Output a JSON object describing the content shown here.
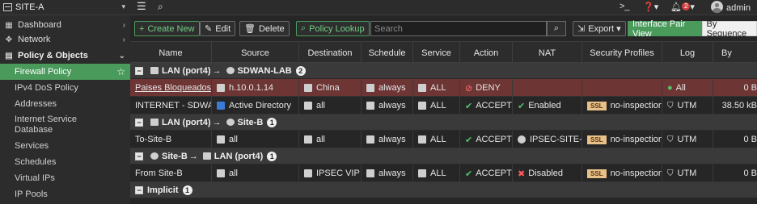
{
  "sidebar": {
    "device_name": "SITE-A",
    "items": [
      {
        "label": "Dashboard",
        "icon": "dashboard-icon"
      },
      {
        "label": "Network",
        "icon": "network-icon"
      },
      {
        "label": "Policy & Objects",
        "icon": "policy-icon"
      }
    ],
    "sub_items": [
      "Firewall Policy",
      "IPv4 DoS Policy",
      "Addresses",
      "Internet Service Database",
      "Services",
      "Schedules",
      "Virtual IPs",
      "IP Pools"
    ]
  },
  "topbar": {
    "menu_icon": "hamburger-icon",
    "search_icon": "search-icon",
    "cli_icon": "terminal-icon",
    "help_icon": "help-icon",
    "notification_count": "2",
    "user": "admin"
  },
  "toolbar": {
    "create_new": "Create New",
    "edit": "Edit",
    "delete": "Delete",
    "policy_lookup": "Policy Lookup",
    "search_placeholder": "Search",
    "export": "Export",
    "view_interface_pair": "Interface Pair View",
    "view_sequence": "By Sequence"
  },
  "table": {
    "columns": [
      "Name",
      "Source",
      "Destination",
      "Schedule",
      "Service",
      "Action",
      "NAT",
      "Security Profiles",
      "Log",
      "By"
    ],
    "groups": [
      {
        "from": "LAN (port4)",
        "to": "SDWAN-LAB",
        "count": "2",
        "rows": [
          {
            "name": "Paises Bloqueados",
            "source": "h.10.0.1.14",
            "destination": "China",
            "schedule": "always",
            "service": "ALL",
            "action": "DENY",
            "nat": "",
            "ssl": "",
            "profile": "",
            "log": "All",
            "bytes": "0 B"
          },
          {
            "name": "INTERNET - SDWAN",
            "source": "Active Directory",
            "destination": "all",
            "schedule": "always",
            "service": "ALL",
            "action": "ACCEPT",
            "nat": "Enabled",
            "ssl": "SSL",
            "profile": "no-inspection",
            "log": "UTM",
            "bytes": "38.50 kB"
          }
        ]
      },
      {
        "from": "LAN (port4)",
        "to": "Site-B",
        "count": "1",
        "rows": [
          {
            "name": "To-Site-B",
            "source": "all",
            "destination": "all",
            "schedule": "always",
            "service": "ALL",
            "action": "ACCEPT",
            "nat": "IPSEC-SITE-A",
            "ssl": "SSL",
            "profile": "no-inspection",
            "log": "UTM",
            "bytes": "0 B"
          }
        ]
      },
      {
        "from": "Site-B",
        "to": "LAN (port4)",
        "count": "1",
        "rows": [
          {
            "name": "From Site-B",
            "source": "all",
            "destination": "IPSEC VIP",
            "schedule": "always",
            "service": "ALL",
            "action": "ACCEPT",
            "nat": "Disabled",
            "ssl": "SSL",
            "profile": "no-inspection",
            "log": "UTM",
            "bytes": "0 B"
          }
        ]
      }
    ],
    "implicit": {
      "label": "Implicit",
      "count": "1"
    }
  }
}
